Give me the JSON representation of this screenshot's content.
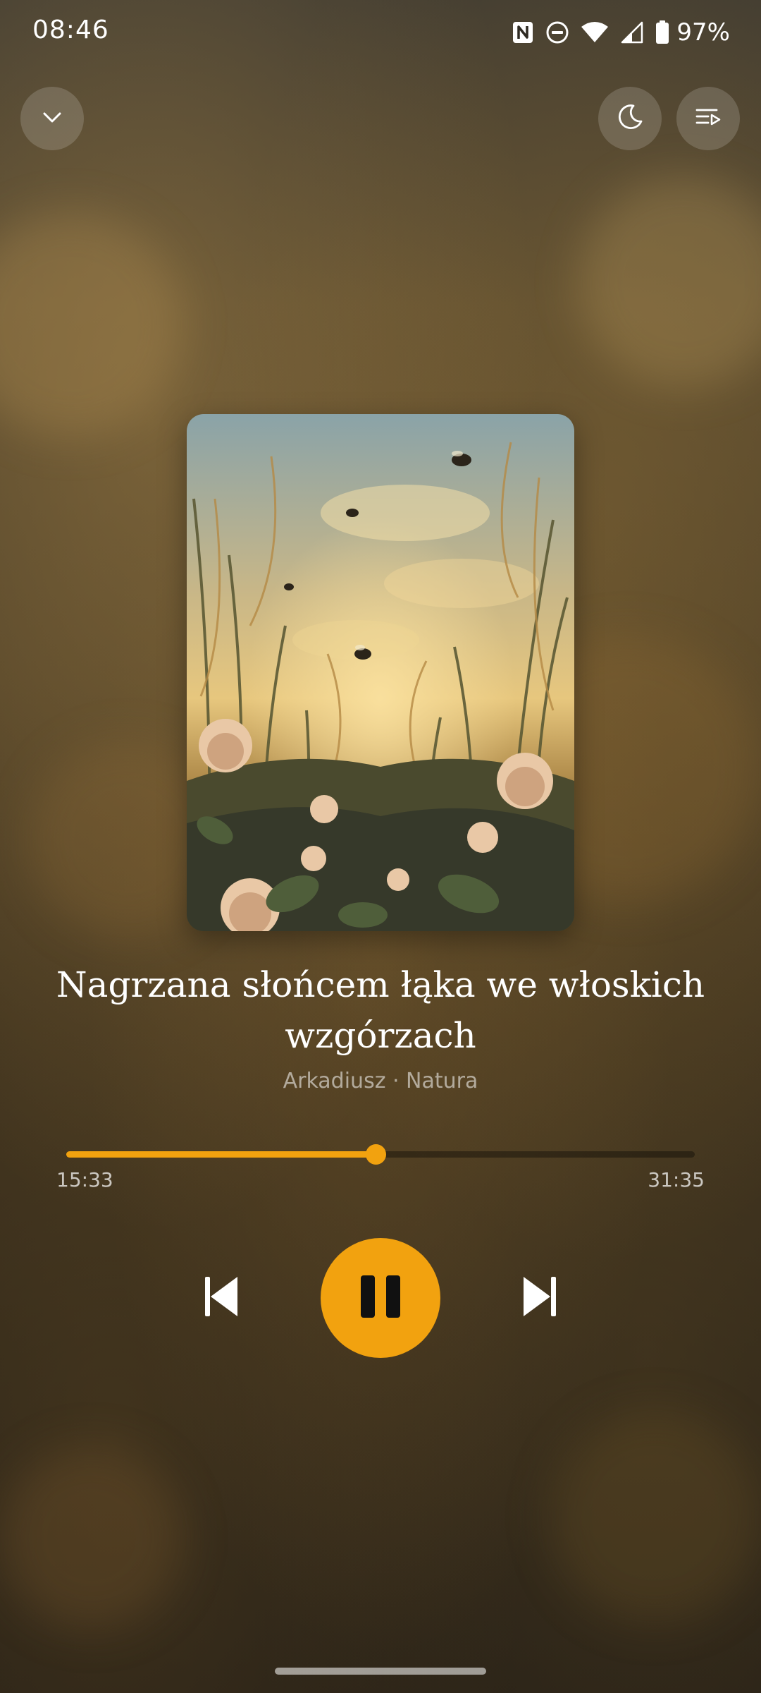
{
  "status_bar": {
    "time": "08:46",
    "battery": "97%",
    "icons": [
      "nfc-icon",
      "do-not-disturb-icon",
      "wifi-icon",
      "cellular-signal-icon",
      "battery-icon"
    ]
  },
  "top_bar": {
    "collapse_icon": "chevron-down-icon",
    "sleep_timer_icon": "moon-icon",
    "queue_icon": "playlist-icon"
  },
  "track": {
    "title": "Nagrzana słońcem łąka we włoskich wzgórzach",
    "meta": "Arkadiusz · Natura"
  },
  "playback": {
    "elapsed": "15:33",
    "total": "31:35",
    "progress": 0.492,
    "state_icon": "pause-icon",
    "previous_icon": "skip-previous-icon",
    "next_icon": "skip-next-icon"
  },
  "colors": {
    "accent": "#f2a20f",
    "text_primary": "#ffffff",
    "text_secondary": "#b3aea4"
  }
}
